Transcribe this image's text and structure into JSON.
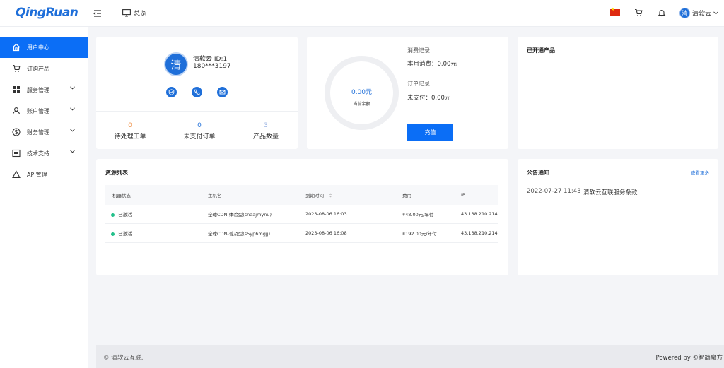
{
  "brand": {
    "logo_text": "QingRuan"
  },
  "header": {
    "overview_label": "总览",
    "user_name": "清软云",
    "avatar_char": "清",
    "icons": [
      "menu-collapse-icon",
      "monitor-icon",
      "china-flag-icon",
      "cart-icon",
      "bell-icon",
      "chevron-down-icon"
    ]
  },
  "sidebar": {
    "items": [
      {
        "label": "用户中心",
        "icon": "home-icon",
        "active": true
      },
      {
        "label": "订购产品",
        "icon": "cart-icon"
      },
      {
        "label": "服务管理",
        "icon": "grid-icon",
        "has_children": true
      },
      {
        "label": "账户管理",
        "icon": "user-icon",
        "has_children": true
      },
      {
        "label": "财务管理",
        "icon": "dollar-icon",
        "has_children": true
      },
      {
        "label": "技术支持",
        "icon": "list-icon",
        "has_children": true
      },
      {
        "label": "API管理",
        "icon": "triangle-icon"
      }
    ]
  },
  "profile": {
    "avatar_char": "清",
    "name_line": "清软云 ID:1",
    "phone": "180***3197",
    "stats": [
      {
        "value": "0",
        "label": "待处理工单",
        "color": "#f0934a"
      },
      {
        "value": "0",
        "label": "未支付订单",
        "color": "#1f6fd9"
      },
      {
        "value": "3",
        "label": "产品数量",
        "color": "#9db5e3"
      }
    ]
  },
  "balance": {
    "amount": "0.00元",
    "amount_label": "当前余额",
    "consumption_title": "消费记录",
    "consumption_value": "本月消费：0.00元",
    "order_title": "订单记录",
    "order_value": "未支付：0.00元",
    "recharge_label": "充值"
  },
  "products": {
    "title": "已开通产品"
  },
  "resources": {
    "title": "资源列表",
    "columns": [
      "机器状态",
      "主机名",
      "到期时间",
      "费用",
      "IP"
    ],
    "rows": [
      {
        "status": "已激活",
        "host": "全球CDN-体验型(snaajmynu)",
        "expire": "2023-08-06 16:03",
        "fee": "¥48.00元/年付",
        "ip": "43.138.210.214"
      },
      {
        "status": "已激活",
        "host": "全球CDN-普及型(s5yp6mgjj)",
        "expire": "2023-08-06 16:08",
        "fee": "¥192.00元/年付",
        "ip": "43.138.210.214"
      }
    ]
  },
  "notice": {
    "title": "公告通知",
    "more_label": "查看更多",
    "items": [
      {
        "date": "2022-07-27 11:43",
        "text": "清软云互联服务条款"
      }
    ]
  },
  "footer": {
    "copyright": "© 清软云互联.",
    "powered": "Powered by ©智简魔方"
  },
  "colors": {
    "accent": "#0b6ef6",
    "brand": "#1f6fd9",
    "status_active": "#22c08a"
  }
}
